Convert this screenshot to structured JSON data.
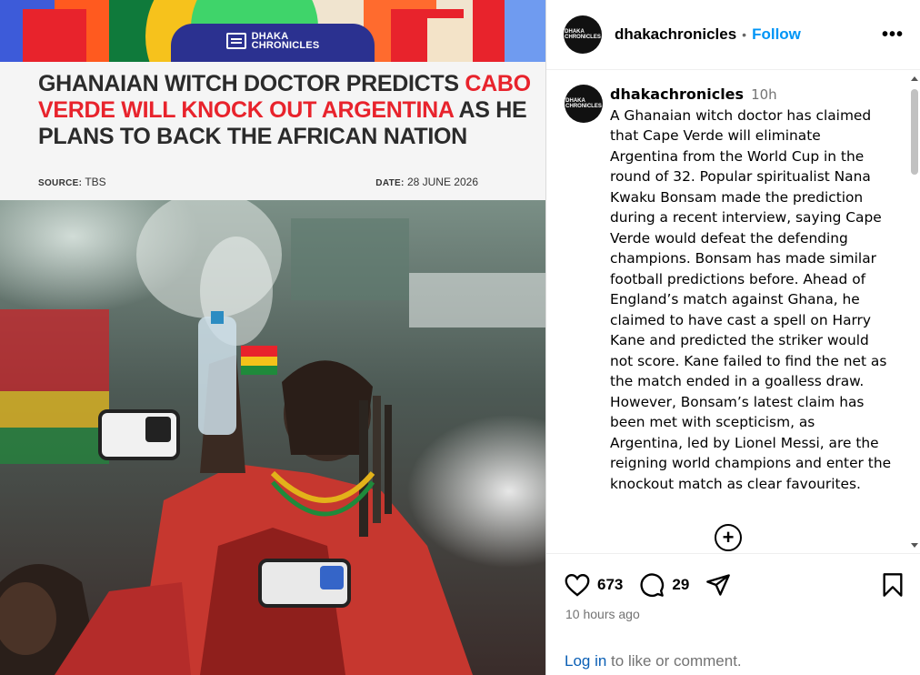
{
  "post": {
    "brand": {
      "line1": "DHAKA",
      "line2": "CHRONICLES"
    },
    "headline": {
      "part1": "GHANAIAN WITCH DOCTOR PREDICTS ",
      "highlight": "CABO VERDE WILL KNOCK OUT ARGENTINA",
      "part2": " AS HE PLANS TO BACK THE AFRICAN NATION"
    },
    "source_label": "SOURCE:",
    "source_value": "TBS",
    "date_label": "DATE:",
    "date_value": "28 JUNE 2026"
  },
  "header": {
    "username": "dhakachronicles",
    "separator": "•",
    "follow_label": "Follow",
    "more_label": "•••",
    "avatar_text": {
      "line1": "DHAKA",
      "line2": "CHRONICLES"
    }
  },
  "caption": {
    "username": "dhakachronicles",
    "time": "10h",
    "text": "A Ghanaian witch doctor has claimed that Cape Verde will eliminate Argentina from the World Cup in the round of 32. Popular spiritualist Nana Kwaku Bonsam made the prediction during a recent interview, saying Cape Verde would defeat the defending champions. Bonsam has made similar football predictions before. Ahead of England’s match against Ghana, he claimed to have cast a spell on Harry Kane and predicted the striker would not score. Kane failed to find the net as the match ended in a goalless draw. However, Bonsam’s latest claim has been met with scepticism, as Argentina, led by Lionel Messi, are the reigning world champions and enter the knockout match as clear favourites.",
    "load_more_label": "+"
  },
  "actions": {
    "like_count": "673",
    "comment_count": "29",
    "time_ago": "10 hours ago",
    "login_link": "Log in",
    "login_suffix": " to like or comment."
  },
  "colors": {
    "accent": "#0095f6",
    "headline_highlight": "#e8232c",
    "brand_pill": "#2b3190",
    "muted_text": "#737373"
  },
  "icons": [
    "heart-icon",
    "comment-icon",
    "share-icon",
    "bookmark-icon",
    "more-icon",
    "plus-circle-icon"
  ]
}
